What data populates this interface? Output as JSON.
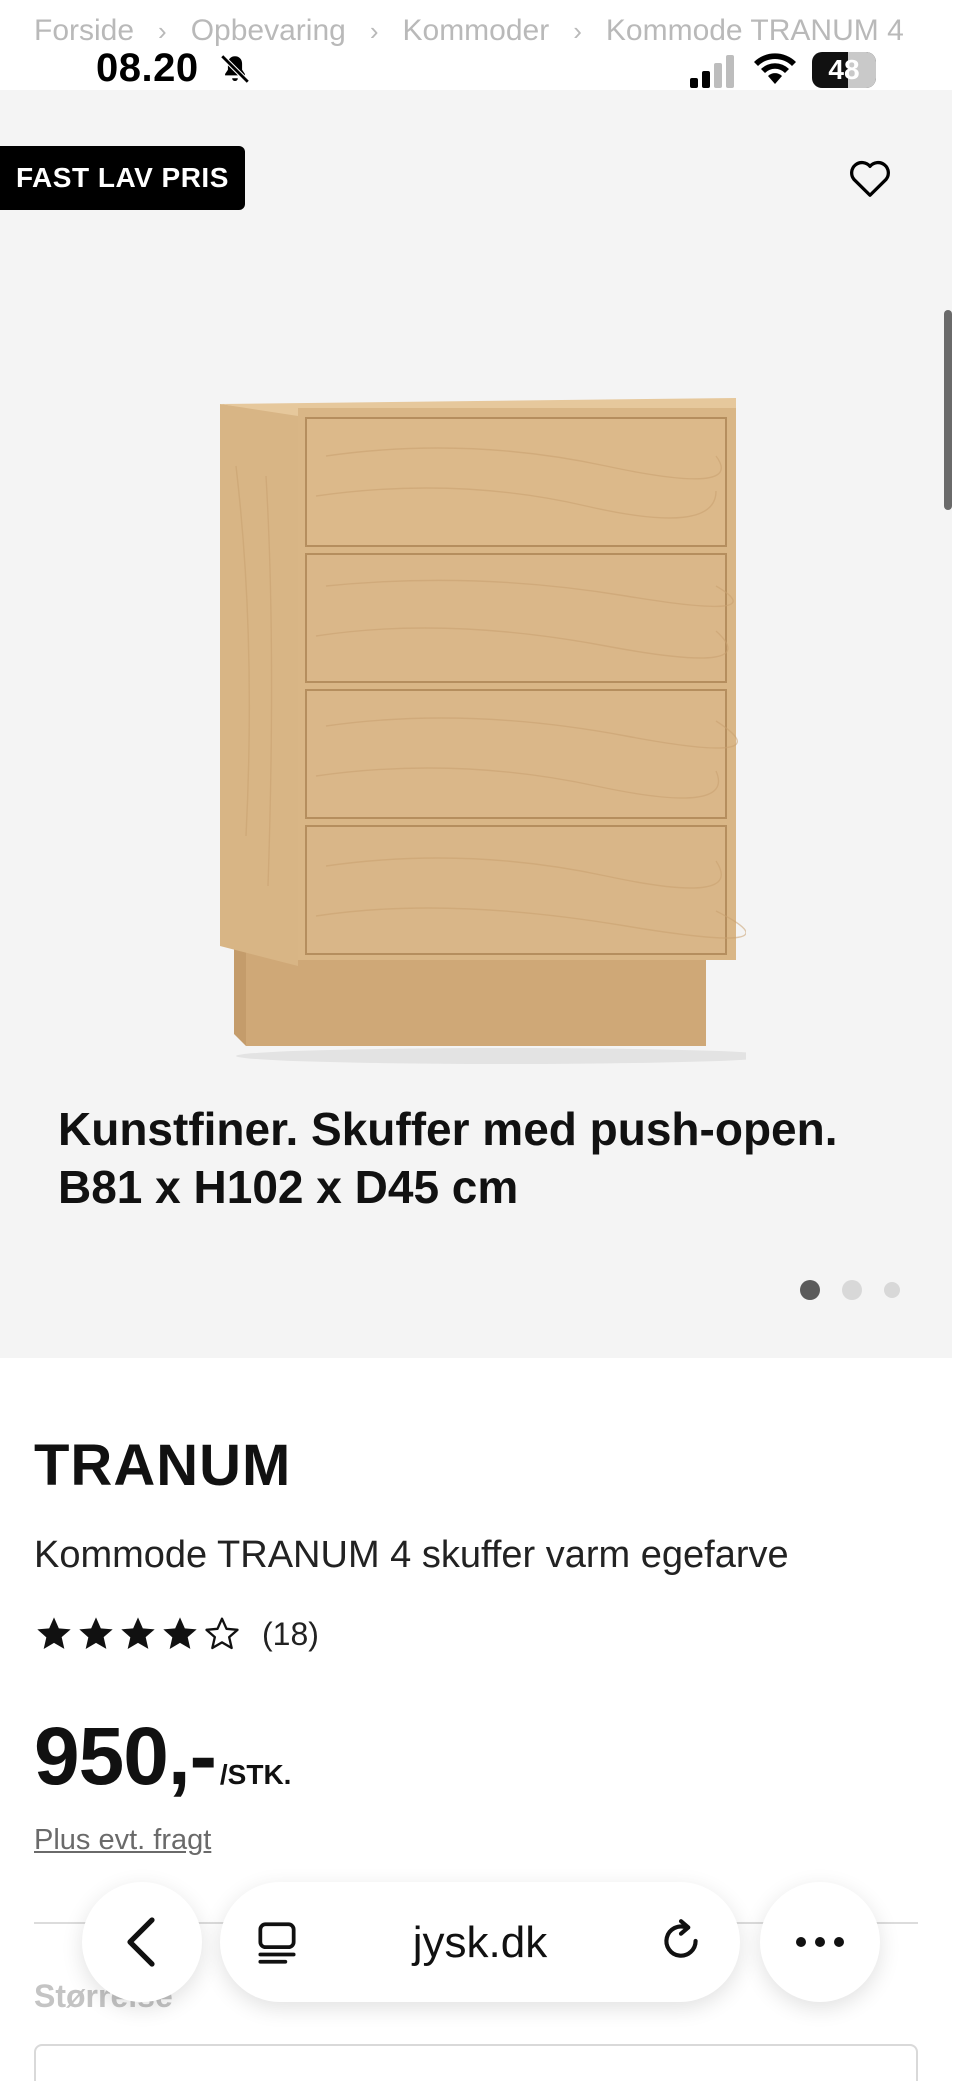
{
  "breadcrumb": [
    "Forside",
    "Opbevaring",
    "Kommoder",
    "Kommode TRANUM 4"
  ],
  "status_bar": {
    "time": "08.20",
    "battery": "48"
  },
  "hero": {
    "badge": "FAST LAV PRIS",
    "caption_line1": "Kunstfiner. Skuffer med push-open.",
    "caption_line2": "B81 x H102 x D45 cm",
    "image_count": 3,
    "active_image": 1
  },
  "product": {
    "brand": "TRANUM",
    "name": "Kommode TRANUM 4 skuffer varm egefarve",
    "rating": 4,
    "rating_max": 5,
    "review_count": "(18)",
    "price": "950,-",
    "price_unit": "/STK.",
    "shipping_note": "Plus evt. fragt",
    "size_label": "Størrelse"
  },
  "browser": {
    "url": "jysk.dk"
  },
  "colors": {
    "badge_bg": "#000000",
    "hero_bg": "#f4f4f4",
    "wood": "#dcb98a"
  }
}
